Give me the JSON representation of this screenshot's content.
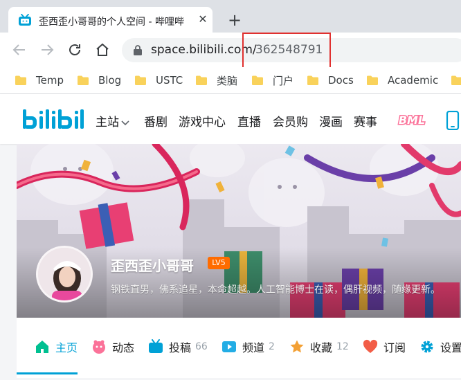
{
  "browser": {
    "tab_title": "歪西歪小哥哥的个人空间 - 哔哩哔",
    "tab_close": "✕",
    "new_tab": "+",
    "url_host": "space.bilibili.com/",
    "url_path": "362548791",
    "bookmarks": [
      "Temp",
      "Blog",
      "USTC",
      "类脑",
      "门户",
      "Docs",
      "Academic"
    ]
  },
  "site": {
    "nav": {
      "main": "主站",
      "items": [
        "番剧",
        "游戏中心",
        "直播",
        "会员购",
        "漫画",
        "赛事"
      ],
      "bml": "BML"
    }
  },
  "profile": {
    "username": "歪西歪小哥哥",
    "level": "LV5",
    "sign": "钢铁直男，佛系追星，本命超越。人工智能博士在读，偶肝视频，随缘更新。",
    "tabs": [
      {
        "label": "主页",
        "count": ""
      },
      {
        "label": "动态",
        "count": ""
      },
      {
        "label": "投稿",
        "count": "66"
      },
      {
        "label": "频道",
        "count": "2"
      },
      {
        "label": "收藏",
        "count": "12"
      },
      {
        "label": "订阅",
        "count": ""
      },
      {
        "label": "设置",
        "count": ""
      }
    ],
    "active_tab": "主页"
  },
  "colors": {
    "bilibili_blue": "#00a1d6",
    "bilibili_pink": "#fb7299",
    "level_orange": "#ff6c00",
    "highlight_red": "#e0302f"
  },
  "icons": [
    "bilibili-tv-icon",
    "back-arrow-icon",
    "forward-arrow-icon",
    "reload-icon",
    "home-icon",
    "lock-icon",
    "folder-icon",
    "chevron-down-icon",
    "phone-icon",
    "home-tab-icon",
    "dynamic-icon",
    "video-icon",
    "channel-icon",
    "star-icon",
    "heart-icon",
    "gear-icon"
  ]
}
